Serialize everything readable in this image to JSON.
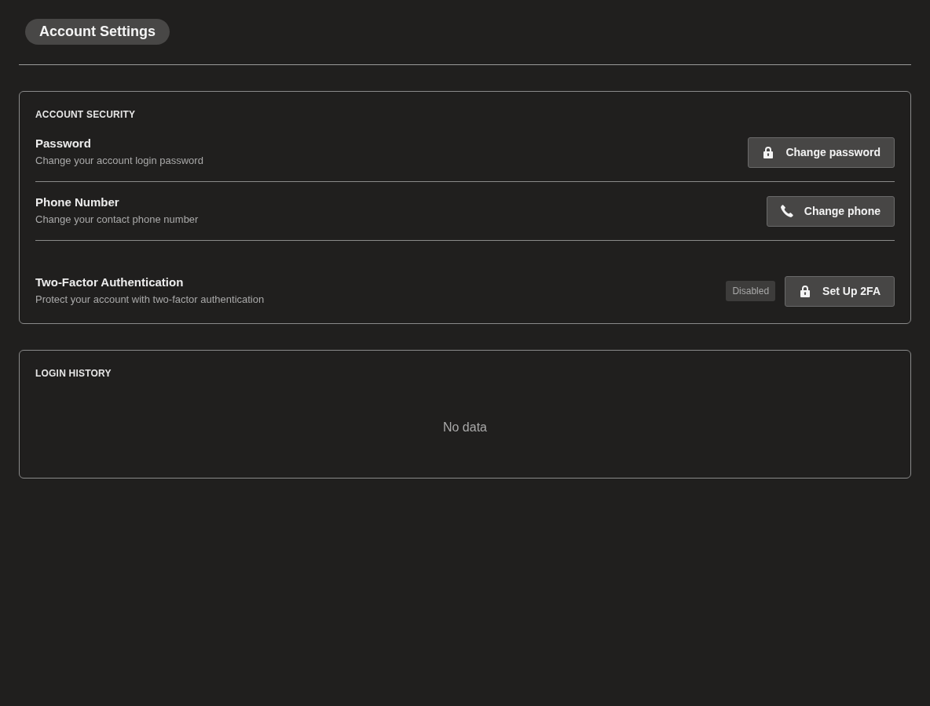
{
  "page": {
    "title": "Account Settings"
  },
  "sections": [
    {
      "kind": "settings",
      "heading": "ACCOUNT SECURITY",
      "rows": [
        {
          "title": "Password",
          "description": "Change your account login password",
          "button": "Change password"
        },
        {
          "title": "Phone Number",
          "description": "Change your contact phone number",
          "button": "Change phone"
        },
        {
          "title": "Two-Factor Authentication",
          "description": "Protect your account with two-factor authentication",
          "badge": {
            "label": "Disabled",
            "active": false
          },
          "button": "Set Up 2FA"
        }
      ]
    },
    {
      "kind": "empty",
      "heading": "LOGIN HISTORY",
      "empty_text": "No data"
    }
  ]
}
